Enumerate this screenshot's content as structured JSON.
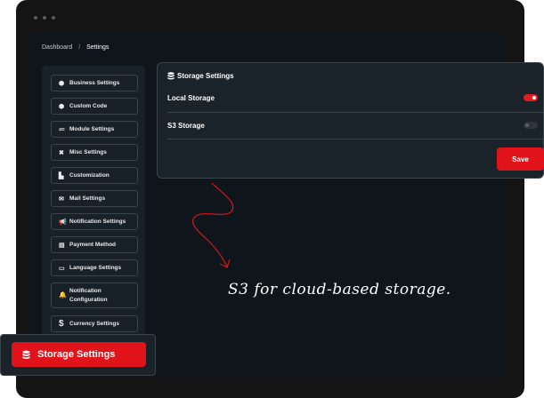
{
  "breadcrumb": {
    "root": "Dashboard",
    "separator": "/",
    "current": "Settings"
  },
  "sidebar": {
    "items": [
      {
        "label": "Business Settings",
        "icon": "cube-icon",
        "glyph": "⬢"
      },
      {
        "label": "Custom Code",
        "icon": "code-icon",
        "glyph": "⬢"
      },
      {
        "label": "Module Settings",
        "icon": "list-icon",
        "glyph": "≔"
      },
      {
        "label": "Misc Settings",
        "icon": "tools-icon",
        "glyph": "✖"
      },
      {
        "label": "Customization",
        "icon": "brush-icon",
        "glyph": "▙"
      },
      {
        "label": "Mail Settings",
        "icon": "envelope-icon",
        "glyph": "✉"
      },
      {
        "label": "Notification Settings",
        "icon": "megaphone-icon",
        "glyph": "📢"
      },
      {
        "label": "Payment Method",
        "icon": "coins-icon",
        "glyph": "▤"
      },
      {
        "label": "Language Settings",
        "icon": "language-icon",
        "glyph": "▭"
      },
      {
        "label": "Notification Configuration",
        "icon": "bell-icon",
        "glyph": "🔔"
      },
      {
        "label": "Currency Settings",
        "icon": "dollar-icon",
        "glyph": "$"
      }
    ]
  },
  "panel": {
    "title": "Storage Settings",
    "icon": "database-icon",
    "rows": [
      {
        "label": "Local Storage",
        "enabled": true
      },
      {
        "label": "S3 Storage",
        "enabled": false
      }
    ],
    "save_label": "Save"
  },
  "highlight": {
    "label": "Storage Settings",
    "icon": "database-icon"
  },
  "annotation": "S3 for cloud-based storage.",
  "colors": {
    "accent": "#e0131b",
    "background": "#0e151b",
    "panel": "#1b232a"
  }
}
